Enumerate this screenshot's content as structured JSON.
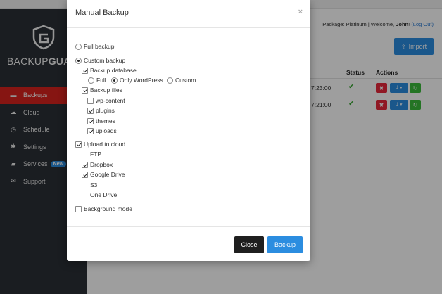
{
  "sidebar": {
    "brand_a": "BACKUP",
    "brand_b": "GUA",
    "items": [
      {
        "label": "Backups",
        "icon": "backups-icon"
      },
      {
        "label": "Cloud",
        "icon": "cloud-icon"
      },
      {
        "label": "Schedule",
        "icon": "clock-icon"
      },
      {
        "label": "Settings",
        "icon": "gear-icon"
      },
      {
        "label": "Services",
        "icon": "briefcase-icon",
        "badge": "New"
      },
      {
        "label": "Support",
        "icon": "envelope-icon"
      }
    ]
  },
  "header": {
    "package_text": "Package: Platinum | Welcome, ",
    "user": "John",
    "sep": "! ",
    "logout": "(Log Out)"
  },
  "main": {
    "import_label": "Import",
    "columns": {
      "status": "Status",
      "actions": "Actions"
    },
    "rows": [
      {
        "time": "7:23:00",
        "status": "success"
      },
      {
        "time": "7:21:00",
        "status": "success"
      }
    ]
  },
  "modal": {
    "title": "Manual Backup",
    "close_glyph": "×",
    "full_backup": "Full backup",
    "custom_backup": "Custom backup",
    "backup_database": "Backup database",
    "db_full": "Full",
    "db_only_wp": "Only WordPress",
    "db_custom": "Custom",
    "backup_files": "Backup files",
    "files": [
      "wp-content",
      "plugins",
      "themes",
      "uploads"
    ],
    "upload_to_cloud": "Upload to cloud",
    "clouds": [
      "FTP",
      "Dropbox",
      "Google Drive",
      "S3",
      "One Drive"
    ],
    "background_mode": "Background mode",
    "close_label": "Close",
    "backup_label": "Backup"
  },
  "colors": {
    "accent": "#2b8de0",
    "danger": "#d9221d",
    "success": "#3aa635",
    "sidebar": "#2b2f36"
  }
}
